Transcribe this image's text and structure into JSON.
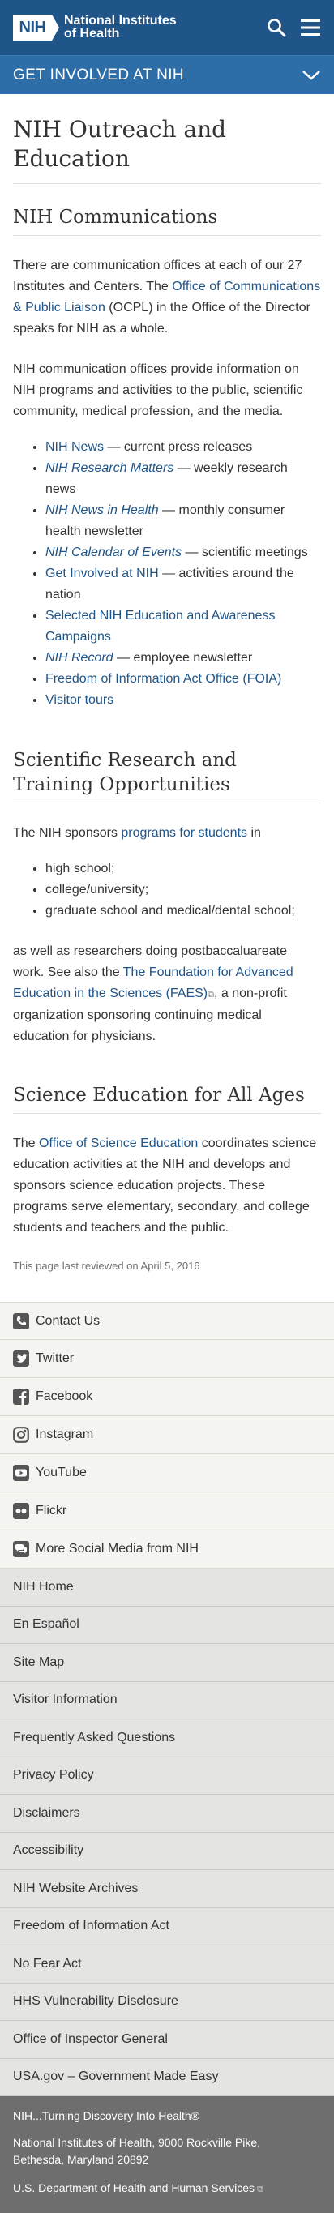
{
  "header": {
    "logo_abbr": "NIH",
    "logo_name_line1": "National Institutes",
    "logo_name_line2": "of Health",
    "section_label": "GET INVOLVED AT NIH"
  },
  "page": {
    "title": "NIH Outreach and Education"
  },
  "communications": {
    "heading": "NIH Communications",
    "para1": {
      "pre": "There are communication offices at each of our 27 Institutes and Centers. The ",
      "link": "Office of Communications & Public Liaison",
      "post": " (OCPL) in the Office of the Director speaks for NIH as a whole."
    },
    "para2": "NIH communication offices provide information on NIH programs and activities to the public, scientific community, medical profession, and the media.",
    "items": [
      {
        "link": "NIH News",
        "desc": " — current press releases"
      },
      {
        "link": "NIH Research Matters",
        "desc": " — weekly research news"
      },
      {
        "link": "NIH News in Health",
        "desc": " — monthly consumer health newsletter"
      },
      {
        "link": "NIH Calendar of Events",
        "desc": " — scientific meetings"
      },
      {
        "link": "Get Involved at NIH",
        "desc": " — activities around the nation"
      },
      {
        "link": "Selected NIH Education and Awareness Campaigns",
        "desc": ""
      },
      {
        "link": "NIH Record",
        "desc": " — employee newsletter"
      },
      {
        "link": "Freedom of Information Act Office (FOIA)",
        "desc": ""
      },
      {
        "link": "Visitor tours",
        "desc": ""
      }
    ]
  },
  "research": {
    "heading": "Scientific Research and Training Opportunities",
    "intro_pre": "The NIH sponsors ",
    "intro_link": "programs for students",
    "intro_post": " in",
    "levels": [
      "high school;",
      "college/university;",
      "graduate school and medical/dental school;"
    ],
    "para_pre": "as well as researchers doing postbaccaluareate work. See also the ",
    "para_link": "The Foundation for Advanced Education in the Sciences (FAES)",
    "para_post": ", a non-profit organization sponsoring continuing medical education for physicians."
  },
  "science_ed": {
    "heading": "Science Education for All Ages",
    "pre": "The ",
    "link": "Office of Science Education",
    "post": " coordinates science education activities at the NIH and develops and sponsors science education projects. These programs serve elementary, secondary, and college students and teachers and the public."
  },
  "reviewed": "This page last reviewed on April 5, 2016",
  "social": [
    {
      "label": "Contact Us",
      "icon": "phone-icon"
    },
    {
      "label": "Twitter",
      "icon": "twitter-icon"
    },
    {
      "label": "Facebook",
      "icon": "facebook-icon"
    },
    {
      "label": "Instagram",
      "icon": "instagram-icon"
    },
    {
      "label": "YouTube",
      "icon": "youtube-icon"
    },
    {
      "label": "Flickr",
      "icon": "flickr-icon"
    },
    {
      "label": "More Social Media from NIH",
      "icon": "chat-icon"
    }
  ],
  "footer_links": [
    "NIH Home",
    "En Español",
    "Site Map",
    "Visitor Information",
    "Frequently Asked Questions",
    "Privacy Policy",
    "Disclaimers",
    "Accessibility",
    "NIH Website Archives",
    "Freedom of Information Act",
    "No Fear Act",
    "HHS Vulnerability Disclosure",
    "Office of Inspector General",
    "USA.gov – Government Made Easy"
  ],
  "bottom": {
    "tagline": "NIH...Turning Discovery Into Health®",
    "address_line1": "National Institutes of Health, 9000 Rockville Pike,",
    "address_line2": "Bethesda, Maryland 20892",
    "hhs": "U.S. Department of Health and Human Services"
  },
  "colors": {
    "header_bg": "#20558a",
    "section_bar_bg": "#2e6ea8",
    "link": "#20558a",
    "bottom_bg": "#6e6e6e"
  }
}
